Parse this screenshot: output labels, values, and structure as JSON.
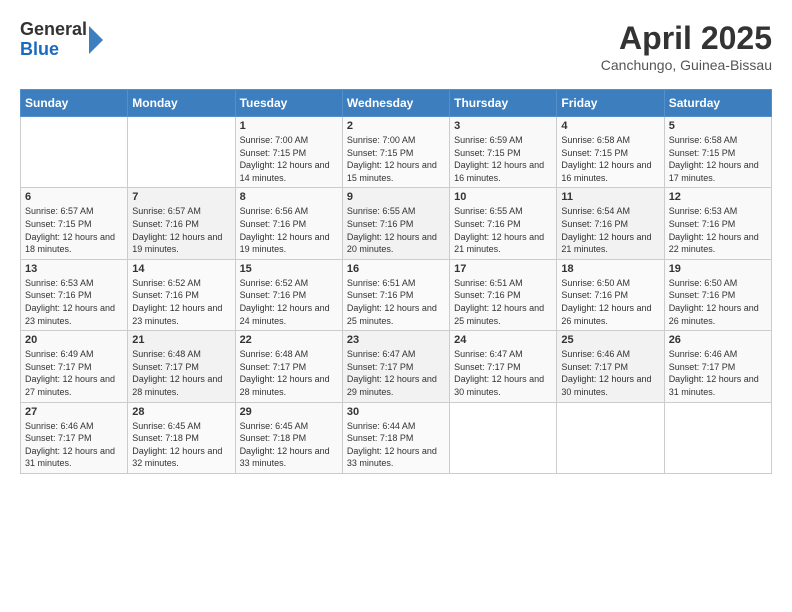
{
  "header": {
    "logo": {
      "general": "General",
      "blue": "Blue"
    },
    "title": "April 2025",
    "subtitle": "Canchungo, Guinea-Bissau"
  },
  "calendar": {
    "days_of_week": [
      "Sunday",
      "Monday",
      "Tuesday",
      "Wednesday",
      "Thursday",
      "Friday",
      "Saturday"
    ],
    "weeks": [
      [
        {
          "day": "",
          "info": ""
        },
        {
          "day": "",
          "info": ""
        },
        {
          "day": "1",
          "info": "Sunrise: 7:00 AM\nSunset: 7:15 PM\nDaylight: 12 hours and 14 minutes."
        },
        {
          "day": "2",
          "info": "Sunrise: 7:00 AM\nSunset: 7:15 PM\nDaylight: 12 hours and 15 minutes."
        },
        {
          "day": "3",
          "info": "Sunrise: 6:59 AM\nSunset: 7:15 PM\nDaylight: 12 hours and 16 minutes."
        },
        {
          "day": "4",
          "info": "Sunrise: 6:58 AM\nSunset: 7:15 PM\nDaylight: 12 hours and 16 minutes."
        },
        {
          "day": "5",
          "info": "Sunrise: 6:58 AM\nSunset: 7:15 PM\nDaylight: 12 hours and 17 minutes."
        }
      ],
      [
        {
          "day": "6",
          "info": "Sunrise: 6:57 AM\nSunset: 7:15 PM\nDaylight: 12 hours and 18 minutes."
        },
        {
          "day": "7",
          "info": "Sunrise: 6:57 AM\nSunset: 7:16 PM\nDaylight: 12 hours and 19 minutes."
        },
        {
          "day": "8",
          "info": "Sunrise: 6:56 AM\nSunset: 7:16 PM\nDaylight: 12 hours and 19 minutes."
        },
        {
          "day": "9",
          "info": "Sunrise: 6:55 AM\nSunset: 7:16 PM\nDaylight: 12 hours and 20 minutes."
        },
        {
          "day": "10",
          "info": "Sunrise: 6:55 AM\nSunset: 7:16 PM\nDaylight: 12 hours and 21 minutes."
        },
        {
          "day": "11",
          "info": "Sunrise: 6:54 AM\nSunset: 7:16 PM\nDaylight: 12 hours and 21 minutes."
        },
        {
          "day": "12",
          "info": "Sunrise: 6:53 AM\nSunset: 7:16 PM\nDaylight: 12 hours and 22 minutes."
        }
      ],
      [
        {
          "day": "13",
          "info": "Sunrise: 6:53 AM\nSunset: 7:16 PM\nDaylight: 12 hours and 23 minutes."
        },
        {
          "day": "14",
          "info": "Sunrise: 6:52 AM\nSunset: 7:16 PM\nDaylight: 12 hours and 23 minutes."
        },
        {
          "day": "15",
          "info": "Sunrise: 6:52 AM\nSunset: 7:16 PM\nDaylight: 12 hours and 24 minutes."
        },
        {
          "day": "16",
          "info": "Sunrise: 6:51 AM\nSunset: 7:16 PM\nDaylight: 12 hours and 25 minutes."
        },
        {
          "day": "17",
          "info": "Sunrise: 6:51 AM\nSunset: 7:16 PM\nDaylight: 12 hours and 25 minutes."
        },
        {
          "day": "18",
          "info": "Sunrise: 6:50 AM\nSunset: 7:16 PM\nDaylight: 12 hours and 26 minutes."
        },
        {
          "day": "19",
          "info": "Sunrise: 6:50 AM\nSunset: 7:16 PM\nDaylight: 12 hours and 26 minutes."
        }
      ],
      [
        {
          "day": "20",
          "info": "Sunrise: 6:49 AM\nSunset: 7:17 PM\nDaylight: 12 hours and 27 minutes."
        },
        {
          "day": "21",
          "info": "Sunrise: 6:48 AM\nSunset: 7:17 PM\nDaylight: 12 hours and 28 minutes."
        },
        {
          "day": "22",
          "info": "Sunrise: 6:48 AM\nSunset: 7:17 PM\nDaylight: 12 hours and 28 minutes."
        },
        {
          "day": "23",
          "info": "Sunrise: 6:47 AM\nSunset: 7:17 PM\nDaylight: 12 hours and 29 minutes."
        },
        {
          "day": "24",
          "info": "Sunrise: 6:47 AM\nSunset: 7:17 PM\nDaylight: 12 hours and 30 minutes."
        },
        {
          "day": "25",
          "info": "Sunrise: 6:46 AM\nSunset: 7:17 PM\nDaylight: 12 hours and 30 minutes."
        },
        {
          "day": "26",
          "info": "Sunrise: 6:46 AM\nSunset: 7:17 PM\nDaylight: 12 hours and 31 minutes."
        }
      ],
      [
        {
          "day": "27",
          "info": "Sunrise: 6:46 AM\nSunset: 7:17 PM\nDaylight: 12 hours and 31 minutes."
        },
        {
          "day": "28",
          "info": "Sunrise: 6:45 AM\nSunset: 7:18 PM\nDaylight: 12 hours and 32 minutes."
        },
        {
          "day": "29",
          "info": "Sunrise: 6:45 AM\nSunset: 7:18 PM\nDaylight: 12 hours and 33 minutes."
        },
        {
          "day": "30",
          "info": "Sunrise: 6:44 AM\nSunset: 7:18 PM\nDaylight: 12 hours and 33 minutes."
        },
        {
          "day": "",
          "info": ""
        },
        {
          "day": "",
          "info": ""
        },
        {
          "day": "",
          "info": ""
        }
      ]
    ]
  }
}
